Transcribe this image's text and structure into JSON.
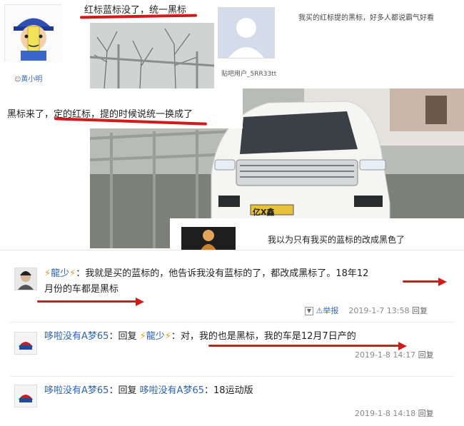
{
  "top": {
    "caption": "红标蓝标没了，统一黑标",
    "username_left": "黄小明",
    "username_right": "贴吧用户_5RR33tt",
    "comment_right": "我买的红标提的黑标，好多人都说霸气好看"
  },
  "middle": {
    "caption": "黑标来了，定的红标，提的时候说统一换成了",
    "plate": "亿X鑫",
    "caption_lower": "我以为只有我买的蓝标的改成黑色了"
  },
  "thread": {
    "comments": [
      {
        "author": "龍少",
        "text_line1": "：我就是买的蓝标的，他告诉我没有蓝标的了，都改成黑标了。18年12",
        "text_line2": "月份的车都是黑标",
        "report": "举报",
        "time": "2019-1-7 13:58",
        "reply": "回复"
      },
      {
        "author": "哆啦没有A梦65",
        "prefix": "：回复",
        "reply_to": "龍少",
        "text": "：对，我的也是黑标，我的车是12月7日产的",
        "time": "2019-1-8 14:17",
        "reply": "回复"
      },
      {
        "author": "哆啦没有A梦65",
        "prefix": "：回复",
        "reply_to": "哆啦没有A梦65",
        "text": "：18运动版",
        "time": "2019-1-8 14:18",
        "reply": "回复"
      }
    ]
  },
  "colors": {
    "accent_red": "#d11a1a",
    "link_blue": "#2d64b3",
    "lightning": "#e79a1b"
  }
}
